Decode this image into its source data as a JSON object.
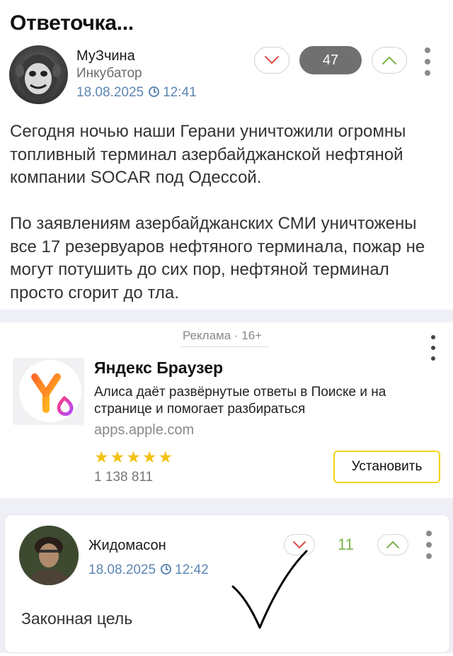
{
  "post": {
    "title": "Ответочка...",
    "author": "МуЗчина",
    "rank": "Инкубатор",
    "date": "18.08.2025",
    "time": "12:41",
    "rating": "47",
    "body_p1": "Сегодня ночью наши Герани уничтожили огромны топливный терминал азербайджанской нефтяной компании SOCAR под Одессой.",
    "body_p2": "По заявлениям азербайджанских СМИ уничтожены все 17 резервуаров нефтяного терминала, пожар не могут потушить до сих пор, нефтяной терминал просто сгорит до тла."
  },
  "ad": {
    "label": "Реклама · 16+",
    "title": "Яндекс Браузер",
    "description": "Алиса даёт развёрнутые ответы в Поиске и на странице и помогает разбираться",
    "domain": "apps.apple.com",
    "stars": "★★★★★",
    "rating_value": 5,
    "reviews_count": "1 138 811",
    "install_label": "Установить"
  },
  "comment": {
    "author": "Жидомасон",
    "date": "18.08.2025",
    "time": "12:42",
    "rating": "11",
    "text": "Законная цель"
  },
  "icons": {
    "downvote": "chevron-down-icon",
    "upvote": "chevron-up-icon",
    "menu": "kebab-menu-icon",
    "clock": "clock-icon",
    "app_logo": "yandex-browser-logo"
  },
  "colors": {
    "link_blue": "#5d86b4",
    "downvote_red": "#e04a4a",
    "upvote_green": "#7bb34a",
    "rating_pill": "#707070",
    "install_border": "#f4d21b",
    "stars": "#f4c20d",
    "separator": "#eef0f6"
  }
}
